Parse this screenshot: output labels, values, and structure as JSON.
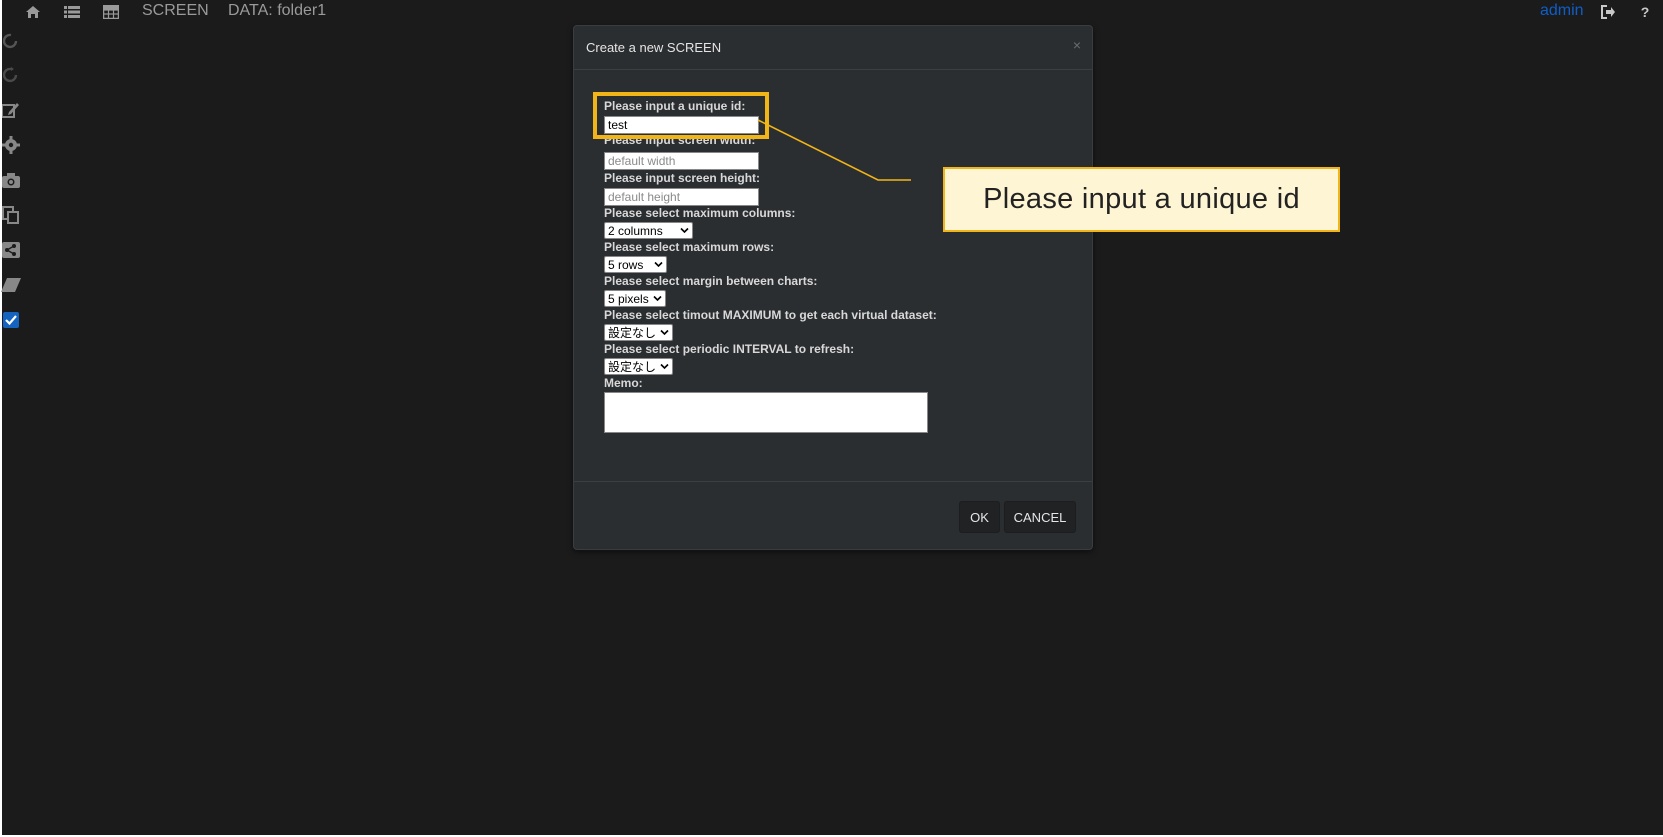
{
  "nav": {
    "screen_label": "SCREEN",
    "data_label": "DATA: folder1",
    "user": "admin"
  },
  "dialog": {
    "title": "Create a new SCREEN",
    "close_glyph": "×",
    "id_label": "Please input a unique id:",
    "id_value": "test",
    "width_label": "Please input screen width:",
    "width_placeholder": "default width",
    "height_label": "Please input screen height:",
    "height_placeholder": "default height",
    "columns_label": "Please select maximum columns:",
    "columns_value": "2 columns",
    "rows_label": "Please select maximum rows:",
    "rows_value": "5 rows",
    "margin_label": "Please select margin between charts:",
    "margin_value": "5 pixels",
    "timeout_label": "Please select timout MAXIMUM to get each virtual dataset:",
    "timeout_value": "設定なし",
    "interval_label": "Please select periodic INTERVAL to refresh:",
    "interval_value": "設定なし",
    "memo_label": "Memo:",
    "ok_label": "OK",
    "cancel_label": "CANCEL"
  },
  "callout": {
    "text": "Please input a unique id"
  },
  "icons": {
    "nav": [
      "home-icon",
      "list-icon",
      "table-icon",
      "logout-icon",
      "help-icon"
    ],
    "sidebar": [
      "undo-icon",
      "redo-icon",
      "edit-icon",
      "gear-icon",
      "camera-icon",
      "copy-icon",
      "share-icon",
      "eraser-icon",
      "checkbox-icon"
    ]
  },
  "colors": {
    "background": "#1b1b1b",
    "dialog": "#2b2e31",
    "highlight": "#f2b517",
    "callout_fill": "#fef5d4",
    "user_link": "#0f5ec8"
  }
}
